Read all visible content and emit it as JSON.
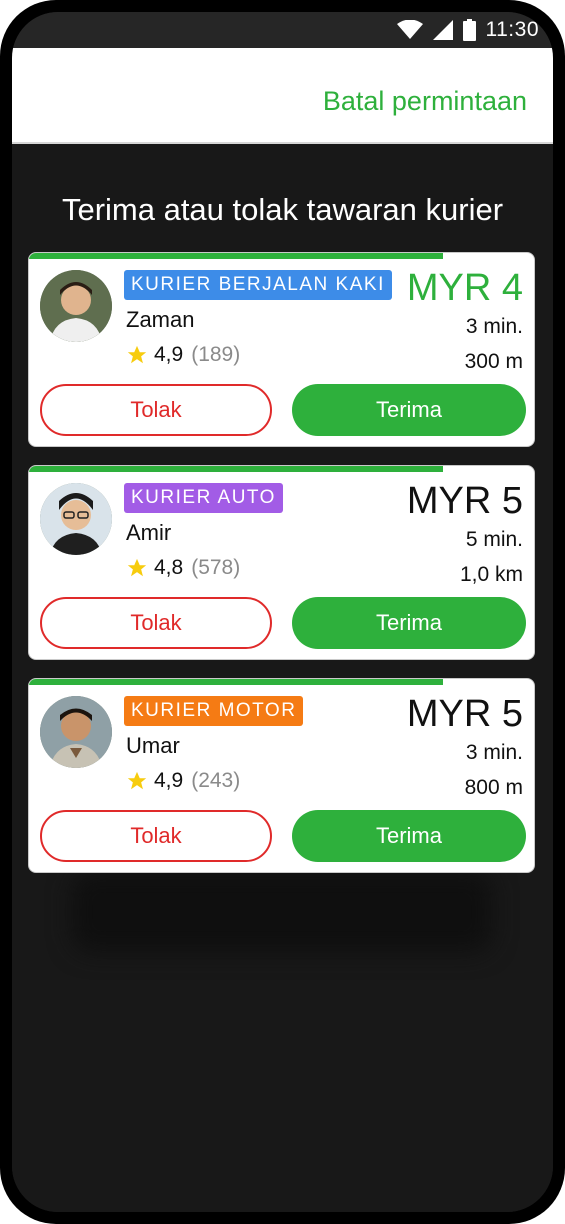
{
  "status_bar": {
    "time": "11:30",
    "icons": [
      "wifi-icon",
      "signal-icon",
      "battery-icon"
    ]
  },
  "header": {
    "cancel_label": "Batal permintaan"
  },
  "main": {
    "heading": "Terima atau tolak tawaran kurier"
  },
  "colors": {
    "accent_green": "#2eb03c",
    "reject_red": "#e02a2a",
    "badge_blue": "#3d8ce8",
    "badge_purple": "#a25ce6",
    "badge_orange": "#f57b14"
  },
  "offers": [
    {
      "type_label": "KURIER BERJALAN KAKI",
      "badge_color": "#3d8ce8",
      "name": "Zaman",
      "rating": "4,9",
      "rating_count": "(189)",
      "price": "MYR 4",
      "price_highlight": true,
      "eta": "3 min.",
      "distance": "300 m",
      "reject_label": "Tolak",
      "accept_label": "Terima",
      "time_remaining_fraction": 0.82
    },
    {
      "type_label": "KURIER AUTO",
      "badge_color": "#a25ce6",
      "name": "Amir",
      "rating": "4,8",
      "rating_count": "(578)",
      "price": "MYR 5",
      "price_highlight": false,
      "eta": "5 min.",
      "distance": "1,0 km",
      "reject_label": "Tolak",
      "accept_label": "Terima",
      "time_remaining_fraction": 0.82
    },
    {
      "type_label": "KURIER MOTOR",
      "badge_color": "#f57b14",
      "name": "Umar",
      "rating": "4,9",
      "rating_count": "(243)",
      "price": "MYR 5",
      "price_highlight": false,
      "eta": "3 min.",
      "distance": "800 m",
      "reject_label": "Tolak",
      "accept_label": "Terima",
      "time_remaining_fraction": 0.82
    }
  ]
}
